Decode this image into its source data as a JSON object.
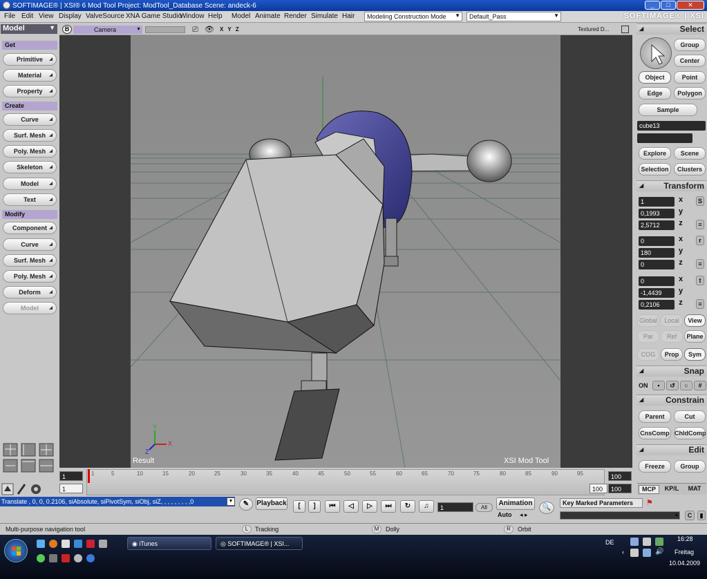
{
  "window": {
    "title": "SOFTIMAGE® | XSI® 6 Mod Tool Project: ModTool_Database   Scene: andeck-6",
    "brand": "SOFTIMAGE® | XSI"
  },
  "menu": [
    "File",
    "Edit",
    "View",
    "Display",
    "ValveSource",
    "XNA Game Studio",
    "Window",
    "Help",
    "Model",
    "Animate",
    "Render",
    "Simulate",
    "Hair"
  ],
  "mode_combo": "Modeling Construction Mode",
  "pass_combo": "Default_Pass",
  "left": {
    "mode": "Model",
    "sections": {
      "get": "Get",
      "create": "Create",
      "modify": "Modify"
    },
    "get_buttons": [
      "Primitive",
      "Material",
      "Property"
    ],
    "create_buttons": [
      "Curve",
      "Surf. Mesh",
      "Poly. Mesh",
      "Skeleton",
      "Model",
      "Text"
    ],
    "modify_buttons": [
      "Component",
      "Curve",
      "Surf. Mesh",
      "Poly. Mesh",
      "Deform",
      "Model"
    ]
  },
  "viewport": {
    "letter": "B",
    "camera": "Camera",
    "axes": "X Y Z",
    "display_mode": "Textured D...",
    "result_label": "Result",
    "watermark": "XSI Mod Tool"
  },
  "right": {
    "select": {
      "title": "Select",
      "group": "Group",
      "center": "Center",
      "object": "Object",
      "point": "Point",
      "edge": "Edge",
      "polygon": "Polygon",
      "sample": "Sample",
      "name_value": "cube13",
      "explore": "Explore",
      "scene": "Scene",
      "selection": "Selection",
      "clusters": "Clusters"
    },
    "transform": {
      "title": "Transform",
      "scale": [
        "1",
        "0,1993",
        "2,5712"
      ],
      "rotate": [
        "0",
        "180",
        "0"
      ],
      "translate": [
        "0",
        "-1,4439",
        "0,2106"
      ],
      "axes": [
        "x",
        "y",
        "z"
      ],
      "spin_labels": [
        "S",
        "r",
        "t"
      ],
      "global": "Global",
      "local": "Local",
      "view": "View",
      "par": "Par",
      "ref": "Ref",
      "plane": "Plane",
      "cog": "COG",
      "prop": "Prop",
      "sym": "Sym"
    },
    "snap": {
      "title": "Snap",
      "on": "ON"
    },
    "constrain": {
      "title": "Constrain",
      "parent": "Parent",
      "cut": "Cut",
      "cnscomp": "CnsComp",
      "chldcomp": "ChldComp"
    },
    "edit": {
      "title": "Edit",
      "freeze": "Freeze",
      "group": "Group"
    },
    "tabs": [
      "MCP",
      "KP/L",
      "MAT"
    ]
  },
  "timeline": {
    "start": "1",
    "current": "1",
    "end": "100",
    "end_top": "100",
    "end_bottom": "100",
    "ticks": [
      "1",
      "5",
      "10",
      "15",
      "20",
      "25",
      "30",
      "35",
      "40",
      "45",
      "50",
      "55",
      "60",
      "65",
      "70",
      "75",
      "80",
      "85",
      "90",
      "95"
    ]
  },
  "command_line": "Translate , 0, 0, 0.2106, siAbsolute, siPivotSym, siObj, siZ, , , , , , , , ,0",
  "playback": {
    "label": "Playback",
    "frame": "1",
    "all": "All",
    "animation": "Animation",
    "auto": "Auto",
    "key_marked": "Key Marked Parameters"
  },
  "status": {
    "message": "Multi-purpose navigation tool",
    "l_key": "L",
    "l_label": "Tracking",
    "m_key": "M",
    "m_label": "Dolly",
    "r_key": "R",
    "r_label": "Orbit"
  },
  "taskbar": {
    "items": [
      "iTunes",
      "SOFTIMAGE® | XSI..."
    ],
    "lang": "DE",
    "time": "16:28",
    "day": "Freitag",
    "date": "10.04.2009"
  }
}
